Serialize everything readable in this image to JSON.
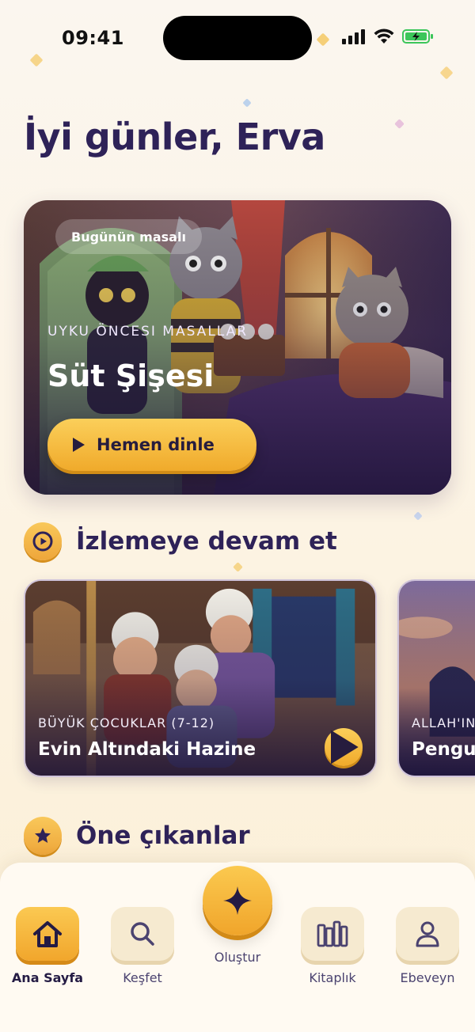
{
  "status_bar": {
    "time": "09:41",
    "icons": [
      "signal-icon",
      "wifi-icon",
      "battery-charging-icon"
    ]
  },
  "greeting": "İyi günler, Erva",
  "hero": {
    "badge": "Bugünün masalı",
    "category": "UYKU ÖNCESI MASALLAR",
    "title": "Süt Şişesi",
    "play_label": "Hemen dinle"
  },
  "continue_section": {
    "title": "İzlemeye devam et",
    "cards": [
      {
        "category": "BÜYÜK ÇOCUKLAR (7-12)",
        "title": "Evin Altındaki Hazine"
      },
      {
        "category": "ALLAH'IN",
        "title": "Pengu"
      }
    ]
  },
  "featured_section": {
    "title": "Öne çıkanlar"
  },
  "nav": {
    "home": "Ana Sayfa",
    "explore": "Keşfet",
    "create": "Oluştur",
    "library": "Kitaplık",
    "parent": "Ebeveyn"
  },
  "colors": {
    "accent": "#f3b23c",
    "heading": "#2e2258",
    "background": "#fbf4e6"
  }
}
